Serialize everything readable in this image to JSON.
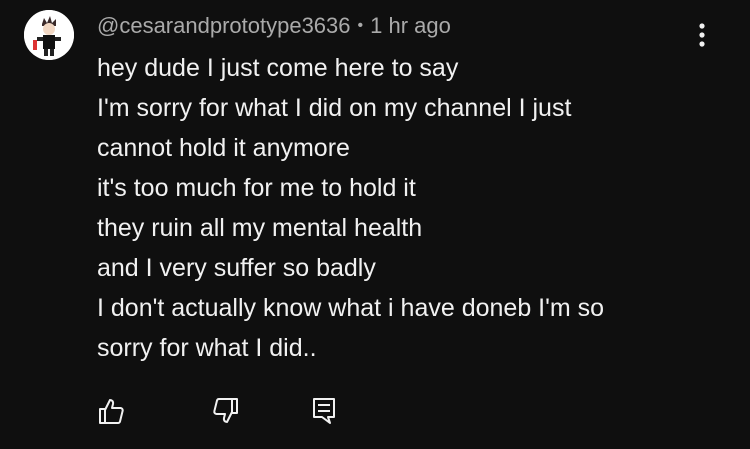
{
  "comment": {
    "author": "@cesarandprototype3636",
    "separator": "•",
    "timestamp": "1 hr ago",
    "lines": [
      "hey dude I just come here to say",
      "I'm sorry for what I did on my channel I just",
      "cannot hold it anymore",
      "it's too much for me to hold it",
      "they ruin all my mental health",
      "and I very suffer so badly",
      "I don't actually know what i have doneb I'm so",
      "sorry for what I did.."
    ]
  },
  "icons": {
    "menu": "more-vertical-icon",
    "like": "thumbs-up-icon",
    "dislike": "thumbs-down-icon",
    "reply": "reply-comment-icon"
  },
  "colors": {
    "background": "#0f0f0f",
    "text_primary": "#f1f1f1",
    "text_secondary": "#aaaaaa"
  }
}
